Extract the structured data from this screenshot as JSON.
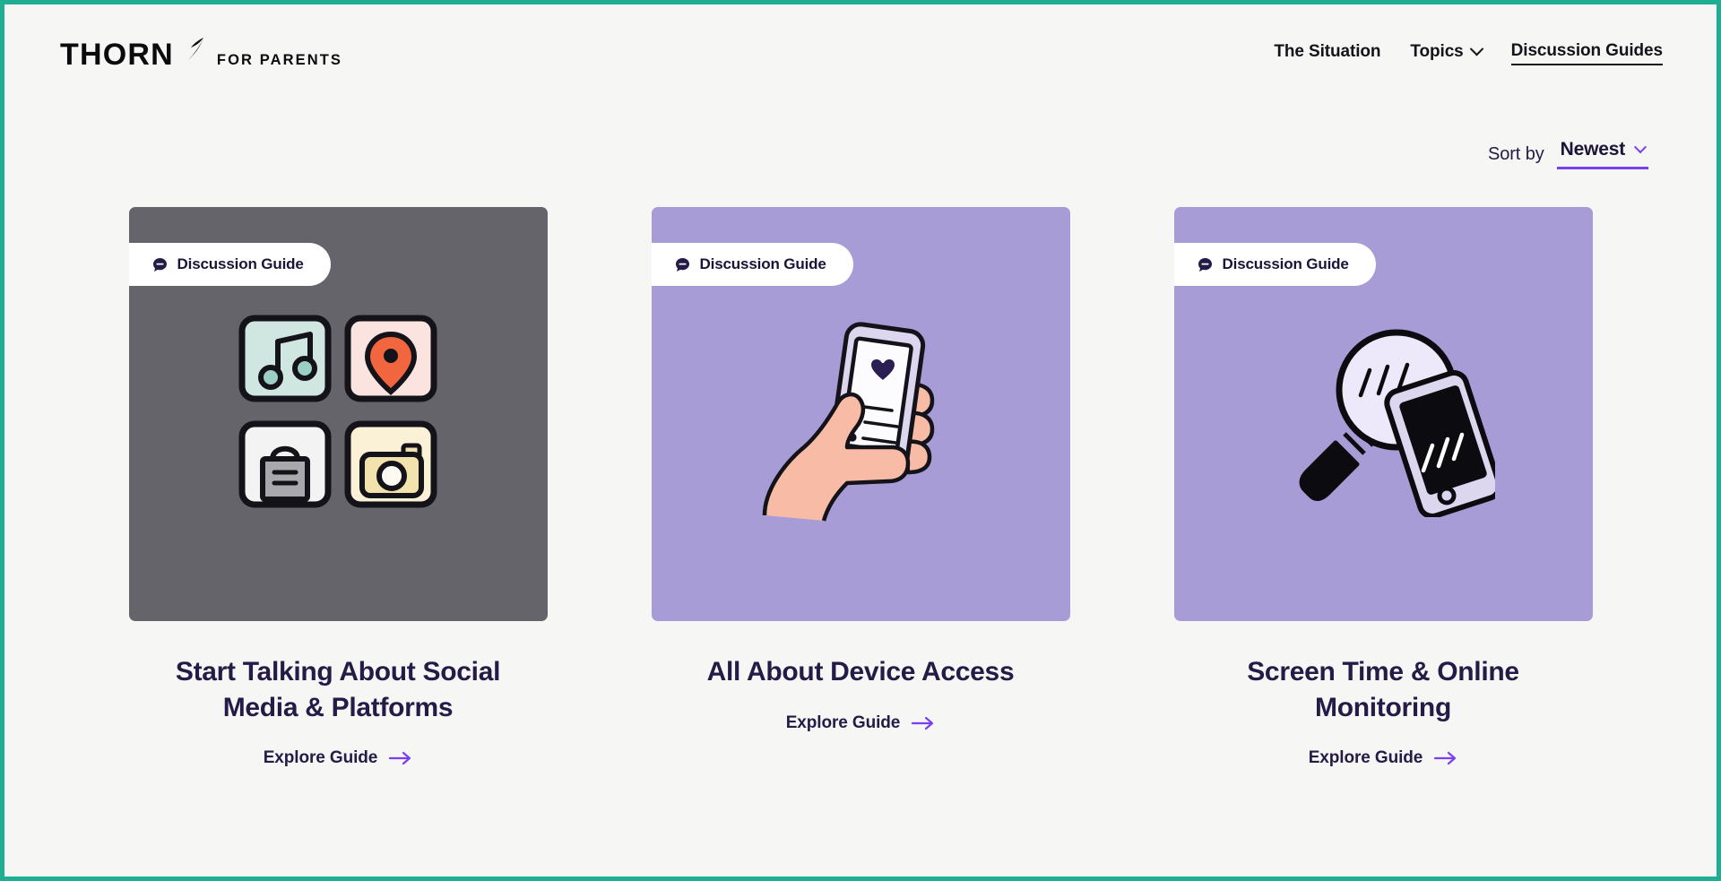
{
  "theme": {
    "page_border": "#1FAE92",
    "page_background": "#F6F6F5",
    "accent_purple": "#7B3FF2",
    "title_navy": "#241B47",
    "card_gray": "#66646B",
    "card_purple": "#A89CD6"
  },
  "header": {
    "logo": {
      "word": "THORN",
      "spark_icon": "spark-arrow-icon",
      "subtitle": "FOR PARENTS"
    },
    "nav": [
      {
        "label": "The Situation",
        "active": false,
        "has_chevron": false
      },
      {
        "label": "Topics",
        "active": false,
        "has_chevron": true
      },
      {
        "label": "Discussion Guides",
        "active": true,
        "has_chevron": false
      }
    ]
  },
  "sort": {
    "label": "Sort by",
    "value": "Newest",
    "chevron_icon": "chevron-down-icon"
  },
  "cards": [
    {
      "badge": {
        "icon": "speech-bubble-icon",
        "label": "Discussion Guide"
      },
      "thumb_color": "#66646B",
      "illustration": "app-icons-grid-illustration",
      "title": "Start Talking About Social Media & Platforms",
      "cta": {
        "label": "Explore Guide",
        "icon": "arrow-right-icon"
      }
    },
    {
      "badge": {
        "icon": "speech-bubble-icon",
        "label": "Discussion Guide"
      },
      "thumb_color": "#A89CD6",
      "illustration": "hand-holding-phone-illustration",
      "title": "All About Device Access",
      "cta": {
        "label": "Explore Guide",
        "icon": "arrow-right-icon"
      }
    },
    {
      "badge": {
        "icon": "speech-bubble-icon",
        "label": "Discussion Guide"
      },
      "thumb_color": "#A89CD6",
      "illustration": "magnifier-over-phone-illustration",
      "title": "Screen Time & Online Monitoring",
      "cta": {
        "label": "Explore Guide",
        "icon": "arrow-right-icon"
      }
    }
  ]
}
